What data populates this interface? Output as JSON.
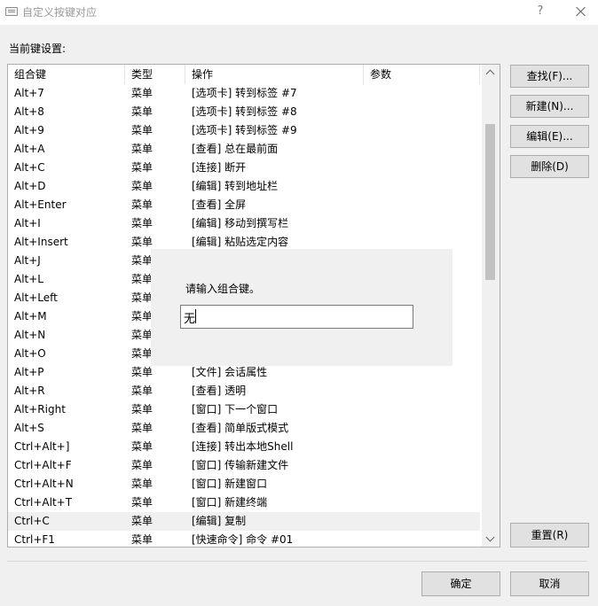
{
  "window": {
    "title": "自定义按键对应",
    "help": "?"
  },
  "section_label": "当前键设置:",
  "columns": [
    "组合键",
    "类型",
    "操作",
    "参数"
  ],
  "rows": [
    {
      "key": "Alt+7",
      "type": "菜单",
      "op": "[选项卡] 转到标签 #7"
    },
    {
      "key": "Alt+8",
      "type": "菜单",
      "op": "[选项卡] 转到标签 #8"
    },
    {
      "key": "Alt+9",
      "type": "菜单",
      "op": "[选项卡] 转到标签 #9"
    },
    {
      "key": "Alt+A",
      "type": "菜单",
      "op": "[查看] 总在最前面"
    },
    {
      "key": "Alt+C",
      "type": "菜单",
      "op": "[连接] 断开"
    },
    {
      "key": "Alt+D",
      "type": "菜单",
      "op": "[编辑] 转到地址栏"
    },
    {
      "key": "Alt+Enter",
      "type": "菜单",
      "op": "[查看] 全屏"
    },
    {
      "key": "Alt+I",
      "type": "菜单",
      "op": "[编辑] 移动到撰写栏"
    },
    {
      "key": "Alt+Insert",
      "type": "菜单",
      "op": "[编辑] 粘贴选定内容"
    },
    {
      "key": "Alt+J",
      "type": "菜单",
      "op": ""
    },
    {
      "key": "Alt+L",
      "type": "菜单",
      "op": ""
    },
    {
      "key": "Alt+Left",
      "type": "菜单",
      "op": ""
    },
    {
      "key": "Alt+M",
      "type": "菜单",
      "op": ""
    },
    {
      "key": "Alt+N",
      "type": "菜单",
      "op": ""
    },
    {
      "key": "Alt+O",
      "type": "菜单",
      "op": ""
    },
    {
      "key": "Alt+P",
      "type": "菜单",
      "op": "[文件] 会话属性"
    },
    {
      "key": "Alt+R",
      "type": "菜单",
      "op": "[查看] 透明"
    },
    {
      "key": "Alt+Right",
      "type": "菜单",
      "op": "[窗口] 下一个窗口"
    },
    {
      "key": "Alt+S",
      "type": "菜单",
      "op": "[查看] 简单版式模式"
    },
    {
      "key": "Ctrl+Alt+]",
      "type": "菜单",
      "op": "[连接] 转出本地Shell"
    },
    {
      "key": "Ctrl+Alt+F",
      "type": "菜单",
      "op": "[窗口] 传输新建文件"
    },
    {
      "key": "Ctrl+Alt+N",
      "type": "菜单",
      "op": "[窗口] 新建窗口"
    },
    {
      "key": "Ctrl+Alt+T",
      "type": "菜单",
      "op": "[窗口] 新建终端"
    },
    {
      "key": "Ctrl+C",
      "type": "菜单",
      "op": "[编辑] 复制",
      "selected": true
    },
    {
      "key": "Ctrl+F1",
      "type": "菜单",
      "op": "[快速命令] 命令 #01"
    }
  ],
  "buttons": {
    "find": "查找(F)...",
    "new": "新建(N)...",
    "edit": "编辑(E)...",
    "delete": "删除(D)",
    "reset": "重置(R)",
    "ok": "确定",
    "cancel": "取消"
  },
  "popup": {
    "label": "请输入组合键。",
    "value": "无"
  }
}
